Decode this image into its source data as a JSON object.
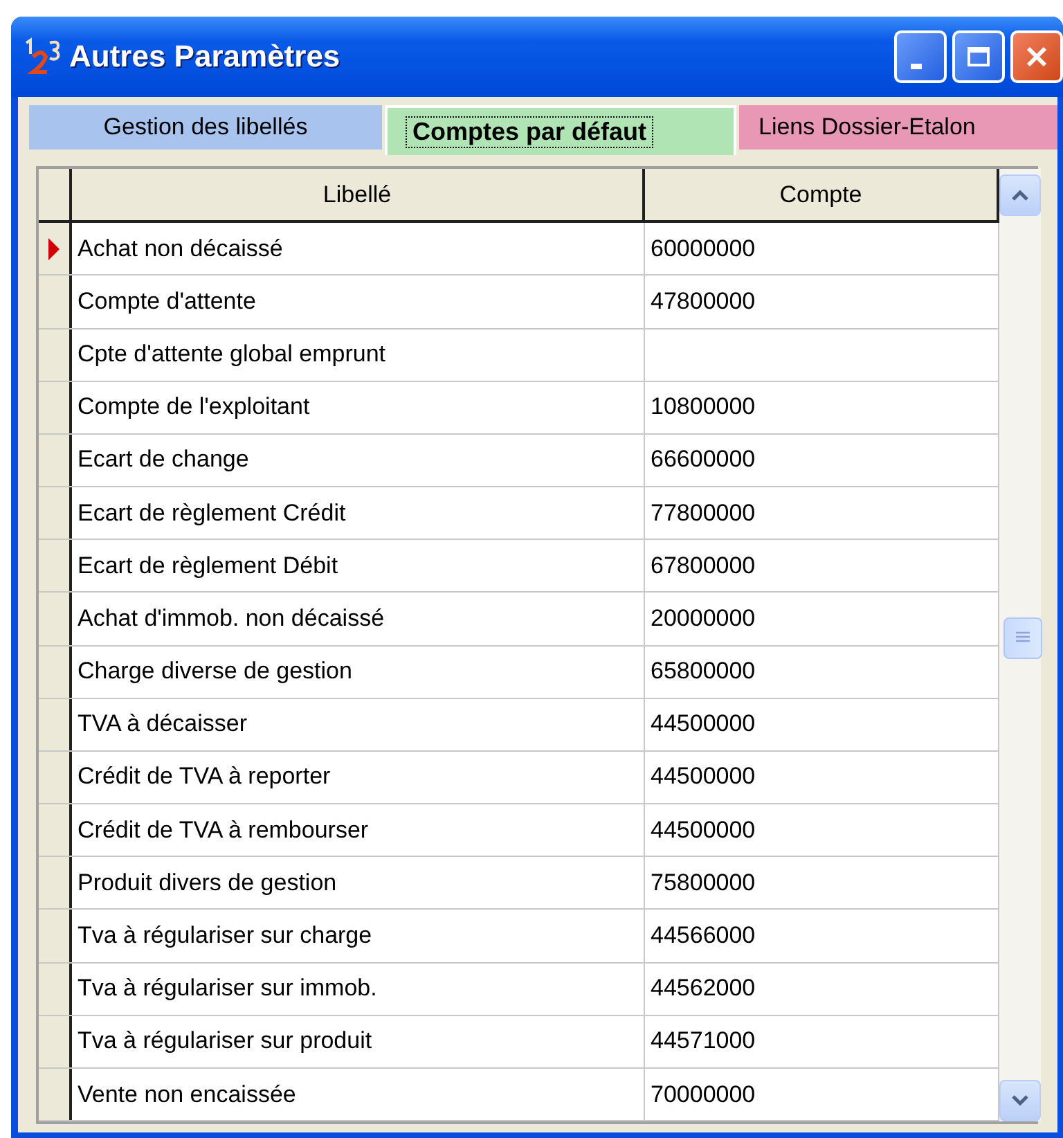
{
  "window": {
    "title": "Autres Paramètres"
  },
  "tabs": [
    {
      "label": "Gestion des libellés",
      "selected": false,
      "color": "#a8c4ee"
    },
    {
      "label": "Comptes par défaut",
      "selected": true,
      "color": "#b0e4b4"
    },
    {
      "label": "Liens Dossier-Etalon",
      "selected": false,
      "color": "#e898b4"
    }
  ],
  "table": {
    "columns": [
      "Libellé",
      "Compte"
    ],
    "rows": [
      {
        "libelle": "Achat non décaissé",
        "compte": "60000000",
        "current": true
      },
      {
        "libelle": "Compte d'attente",
        "compte": "47800000",
        "current": false
      },
      {
        "libelle": "Cpte d'attente global emprunt",
        "current": false
      },
      {
        "libelle": "Compte de l'exploitant",
        "compte": "10800000",
        "current": false
      },
      {
        "libelle": "Ecart de change",
        "compte": "66600000",
        "current": false
      },
      {
        "libelle": "Ecart de règlement Crédit",
        "compte": "77800000",
        "current": false
      },
      {
        "libelle": "Ecart de règlement Débit",
        "compte": "67800000",
        "current": false
      },
      {
        "libelle": "Achat d'immob. non décaissé",
        "compte": "20000000",
        "current": false
      },
      {
        "libelle": "Charge diverse de gestion",
        "compte": "65800000",
        "current": false
      },
      {
        "libelle": "TVA à décaisser",
        "compte": "44500000",
        "current": false
      },
      {
        "libelle": "Crédit de TVA à reporter",
        "compte": "44500000",
        "current": false
      },
      {
        "libelle": "Crédit de TVA à rembourser",
        "compte": "44500000",
        "current": false
      },
      {
        "libelle": "Produit divers de gestion",
        "compte": "75800000",
        "current": false
      },
      {
        "libelle": "Tva à régulariser sur charge",
        "compte": "44566000",
        "current": false
      },
      {
        "libelle": "Tva à régulariser sur immob.",
        "compte": "44562000",
        "current": false
      },
      {
        "libelle": "Tva à régulariser sur produit",
        "compte": "44571000",
        "current": false
      },
      {
        "libelle": "Vente non encaissée",
        "compte": "70000000",
        "current": false
      }
    ]
  }
}
